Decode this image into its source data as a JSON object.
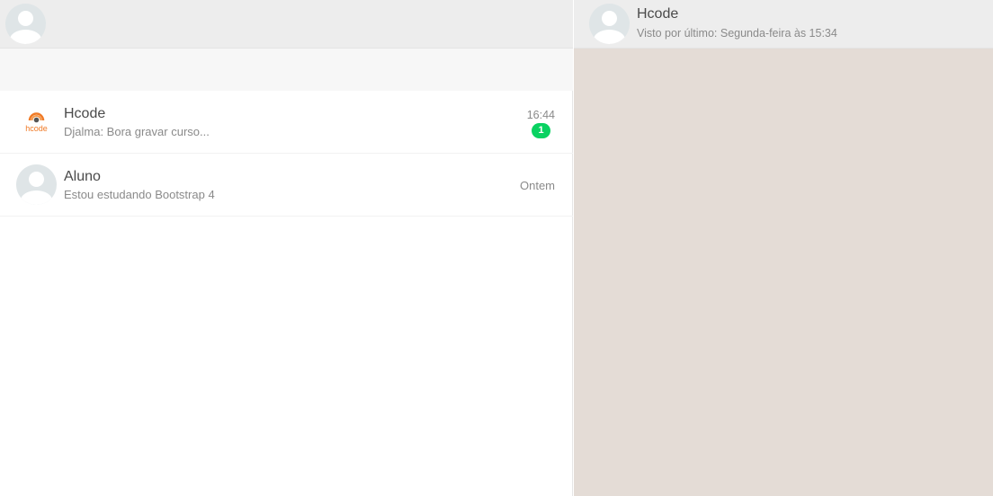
{
  "sidebar": {
    "chats": [
      {
        "name": "Hcode",
        "preview": "Djalma: Bora gravar curso...",
        "time": "16:44",
        "unread": "1",
        "logo_text": "hcode"
      },
      {
        "name": "Aluno",
        "preview": "Estou estudando Bootstrap 4",
        "time": "Ontem"
      }
    ]
  },
  "conversation": {
    "contact_name": "Hcode",
    "last_seen": "Visto por último: Segunda-feira às 15:34"
  },
  "colors": {
    "badge": "#09d261",
    "header_bg": "#ededed",
    "chat_bg": "#e4dcd6",
    "logo_orange": "#f07a26"
  }
}
